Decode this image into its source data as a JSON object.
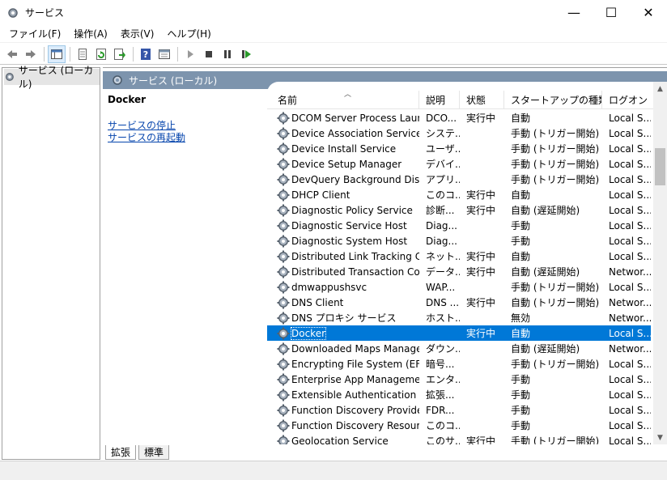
{
  "window": {
    "title": "サービス",
    "minimize": "—",
    "maximize": "☐",
    "close": "✕"
  },
  "menu": [
    "ファイル(F)",
    "操作(A)",
    "表示(V)",
    "ヘルプ(H)"
  ],
  "tree": {
    "root_label": "サービス (ローカル)"
  },
  "panel": {
    "header": "サービス (ローカル)"
  },
  "details": {
    "selected_name": "Docker",
    "link_stop": "サービスの停止",
    "link_restart": "サービスの再起動"
  },
  "columns": {
    "name": "名前",
    "desc": "説明",
    "status": "状態",
    "startup": "スタートアップの種類",
    "logon": "ログオン"
  },
  "rows": [
    {
      "name": "DCOM Server Process Laun...",
      "desc": "DCO...",
      "status": "実行中",
      "startup": "自動",
      "logon": "Local S..."
    },
    {
      "name": "Device Association Service",
      "desc": "システ...",
      "status": "",
      "startup": "手動 (トリガー開始)",
      "logon": "Local S..."
    },
    {
      "name": "Device Install Service",
      "desc": "ユーザ...",
      "status": "",
      "startup": "手動 (トリガー開始)",
      "logon": "Local S..."
    },
    {
      "name": "Device Setup Manager",
      "desc": "デバイ...",
      "status": "",
      "startup": "手動 (トリガー開始)",
      "logon": "Local S..."
    },
    {
      "name": "DevQuery Background Disc...",
      "desc": "アプリ...",
      "status": "",
      "startup": "手動 (トリガー開始)",
      "logon": "Local S..."
    },
    {
      "name": "DHCP Client",
      "desc": "このコ...",
      "status": "実行中",
      "startup": "自動",
      "logon": "Local S..."
    },
    {
      "name": "Diagnostic Policy Service",
      "desc": "診断...",
      "status": "実行中",
      "startup": "自動 (遅延開始)",
      "logon": "Local S..."
    },
    {
      "name": "Diagnostic Service Host",
      "desc": "Diag...",
      "status": "",
      "startup": "手動",
      "logon": "Local S..."
    },
    {
      "name": "Diagnostic System Host",
      "desc": "Diag...",
      "status": "",
      "startup": "手動",
      "logon": "Local S..."
    },
    {
      "name": "Distributed Link Tracking Cli...",
      "desc": "ネット...",
      "status": "実行中",
      "startup": "自動",
      "logon": "Local S..."
    },
    {
      "name": "Distributed Transaction Coo...",
      "desc": "データ...",
      "status": "実行中",
      "startup": "自動 (遅延開始)",
      "logon": "Networ..."
    },
    {
      "name": "dmwappushsvc",
      "desc": "WAP...",
      "status": "",
      "startup": "手動 (トリガー開始)",
      "logon": "Local S..."
    },
    {
      "name": "DNS Client",
      "desc": "DNS ...",
      "status": "実行中",
      "startup": "自動 (トリガー開始)",
      "logon": "Networ..."
    },
    {
      "name": "DNS プロキシ サービス",
      "desc": "ホスト...",
      "status": "",
      "startup": "無効",
      "logon": "Networ..."
    },
    {
      "name": "Docker",
      "desc": "",
      "status": "実行中",
      "startup": "自動",
      "logon": "Local S...",
      "selected": true
    },
    {
      "name": "Downloaded Maps Manager",
      "desc": "ダウン...",
      "status": "",
      "startup": "自動 (遅延開始)",
      "logon": "Networ..."
    },
    {
      "name": "Encrypting File System (EFS)",
      "desc": "暗号...",
      "status": "",
      "startup": "手動 (トリガー開始)",
      "logon": "Local S..."
    },
    {
      "name": "Enterprise App Managemen...",
      "desc": "エンタ...",
      "status": "",
      "startup": "手動",
      "logon": "Local S..."
    },
    {
      "name": "Extensible Authentication P...",
      "desc": "拡張...",
      "status": "",
      "startup": "手動",
      "logon": "Local S..."
    },
    {
      "name": "Function Discovery Provider...",
      "desc": "FDR...",
      "status": "",
      "startup": "手動",
      "logon": "Local S..."
    },
    {
      "name": "Function Discovery Resourc...",
      "desc": "このコ...",
      "status": "",
      "startup": "手動",
      "logon": "Local S..."
    },
    {
      "name": "Geolocation Service",
      "desc": "このサ...",
      "status": "実行中",
      "startup": "手動 (トリガー開始)",
      "logon": "Local S..."
    }
  ],
  "tabs": {
    "extended": "拡張",
    "standard": "標準"
  },
  "icons": {
    "title": "gear-icon",
    "toolbar": [
      "back-arrow-icon",
      "forward-arrow-icon",
      "console-tree-icon",
      "properties-icon",
      "refresh-icon",
      "export-icon",
      "help-icon",
      "view-icon",
      "play-icon",
      "stop-icon",
      "pause-icon",
      "restart-icon"
    ]
  },
  "colors": {
    "selection": "#0078d7",
    "panel_header": "#7d94ad",
    "link": "#0645ad"
  }
}
